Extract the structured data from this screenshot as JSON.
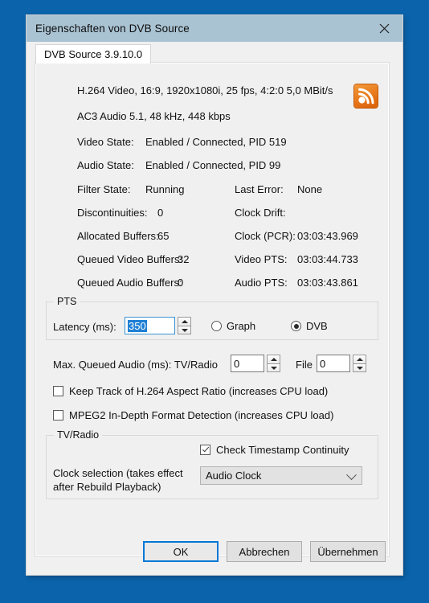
{
  "window": {
    "title": "Eigenschaften von DVB Source",
    "close_icon": "close-icon"
  },
  "tab": {
    "label": "DVB Source 3.9.10.0"
  },
  "stream_info": {
    "video_line": "H.264 Video, 16:9, 1920x1080i, 25 fps, 4:2:0   5,0 MBit/s",
    "audio_line": "AC3 Audio 5.1, 48 kHz, 448 kbps",
    "icon": "broadcast-antenna-icon"
  },
  "states": {
    "video_state_label": "Video State:",
    "video_state_value": "Enabled / Connected, PID 519",
    "audio_state_label": "Audio State:",
    "audio_state_value": "Enabled / Connected, PID 99"
  },
  "stats": {
    "left": [
      {
        "label": "Filter State:",
        "value": "Running"
      },
      {
        "label": "Discontinuities:",
        "value": "0"
      },
      {
        "label": "Allocated Buffers:",
        "value": "65"
      },
      {
        "label": "Queued Video Buffers:",
        "value": "32"
      },
      {
        "label": "Queued Audio Buffers:",
        "value": "0"
      }
    ],
    "right": [
      {
        "label": "Last Error:",
        "value": "None"
      },
      {
        "label": "Clock Drift:",
        "value": ""
      },
      {
        "label": "Clock (PCR):",
        "value": "03:03:43.969"
      },
      {
        "label": "Video PTS:",
        "value": "03:03:44.733"
      },
      {
        "label": "Audio PTS:",
        "value": "03:03:43.861"
      }
    ]
  },
  "pts_group": {
    "title": "PTS",
    "latency_label": "Latency (ms):",
    "latency_value": "350",
    "radios": [
      {
        "label": "Graph",
        "checked": false
      },
      {
        "label": "DVB",
        "checked": true
      }
    ]
  },
  "max_queued_audio": {
    "label": "Max. Queued Audio (ms): TV/Radio",
    "tvradio_value": "0",
    "file_label": "File",
    "file_value": "0"
  },
  "checkboxes": [
    {
      "label": "Keep Track of H.264 Aspect Ratio (increases CPU load)",
      "checked": false
    },
    {
      "label": "MPEG2 In-Depth Format Detection (increases CPU load)",
      "checked": false
    }
  ],
  "tvradio_group": {
    "title": "TV/Radio",
    "timestamp_checkbox": {
      "label": "Check Timestamp Continuity",
      "checked": true
    },
    "clock_label_line1": "Clock selection (takes effect",
    "clock_label_line2": "after Rebuild Playback)",
    "clock_value": "Audio Clock"
  },
  "footer": {
    "ok": "OK",
    "cancel": "Abbrechen",
    "apply": "Übernehmen"
  },
  "colors": {
    "desktop": "#0b63ab",
    "titlebar": "#a9c3d3",
    "dialog": "#f0f0f0",
    "accent": "#0078d7",
    "icon_orange": "#e8781b",
    "selection": "#1f7fd4"
  }
}
